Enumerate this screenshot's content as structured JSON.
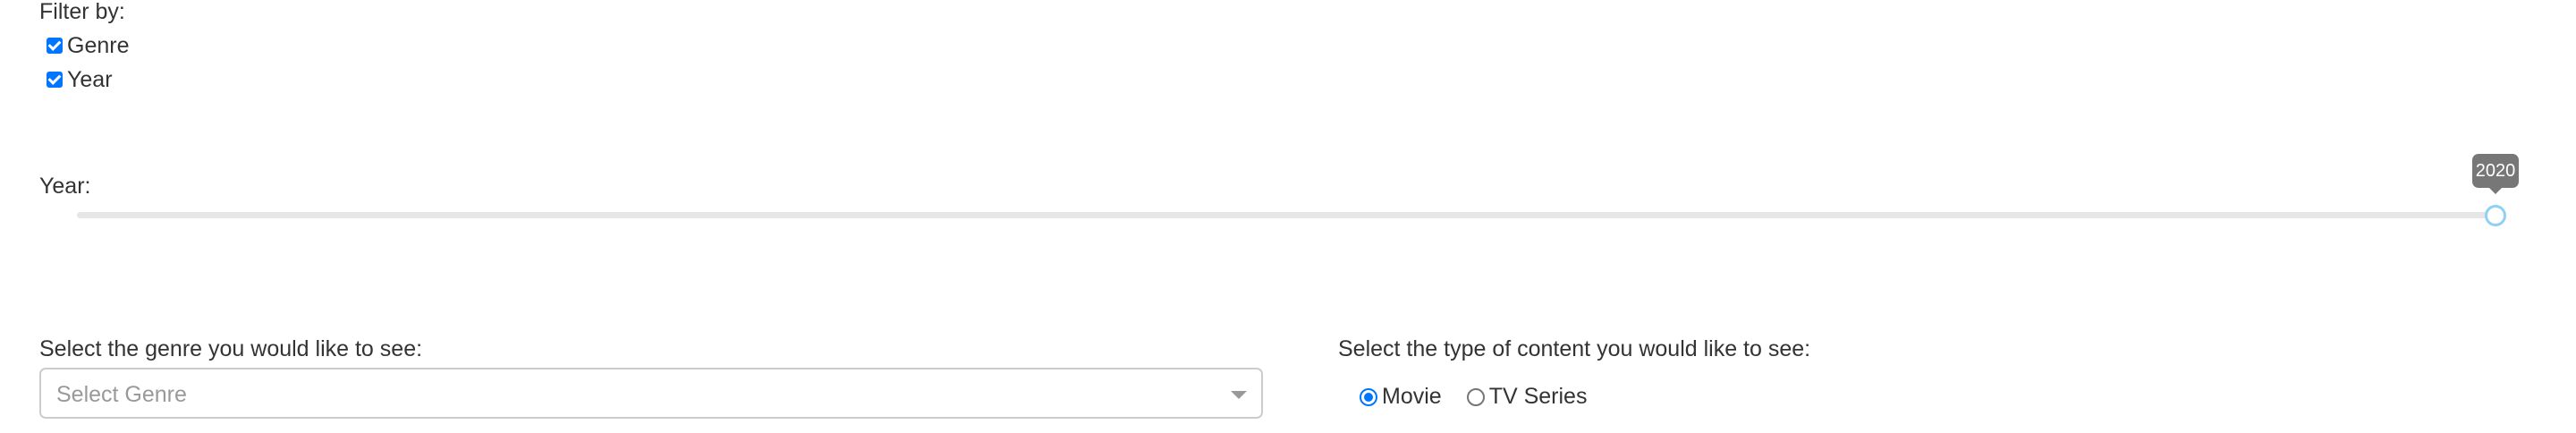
{
  "filter": {
    "title": "Filter by:",
    "options": [
      {
        "label": "Genre",
        "checked": true
      },
      {
        "label": "Year",
        "checked": true
      }
    ]
  },
  "year": {
    "label": "Year:",
    "value": "2020"
  },
  "genre": {
    "label": "Select the genre you would like to see:",
    "placeholder": "Select Genre"
  },
  "content_type": {
    "label": "Select the type of content you would like to see:",
    "options": [
      {
        "label": "Movie",
        "selected": true
      },
      {
        "label": "TV Series",
        "selected": false
      }
    ]
  },
  "colors": {
    "accent": "#0075ff",
    "slider_handle": "#8fd1f5",
    "tooltip_bg": "#777777"
  }
}
